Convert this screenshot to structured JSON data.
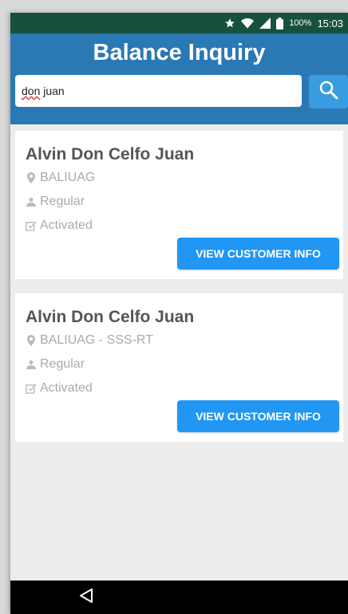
{
  "status_bar": {
    "icons": [
      "star-icon",
      "wifi-icon",
      "signal-icon",
      "battery-icon"
    ],
    "battery_percent": "100%",
    "time": "15:03"
  },
  "header": {
    "title": "Balance Inquiry",
    "color": "#2b79b4"
  },
  "search": {
    "value_part1": "don",
    "value_part2": " juan",
    "button_icon": "search-icon"
  },
  "results": [
    {
      "name": "Alvin Don Celfo Juan",
      "branch": "BALIUAG",
      "type": "Regular",
      "status": "Activated",
      "button_label": "VIEW CUSTOMER INFO"
    },
    {
      "name": "Alvin Don Celfo Juan",
      "branch": "BALIUAG - SSS-RT",
      "type": "Regular",
      "status": "Activated",
      "button_label": "VIEW CUSTOMER INFO"
    }
  ],
  "colors": {
    "status_bar": "#17503f",
    "accent_button": "#2196f3",
    "search_button": "#3a9ce0"
  },
  "nav_bar": {
    "back_icon": "back-triangle-icon"
  }
}
